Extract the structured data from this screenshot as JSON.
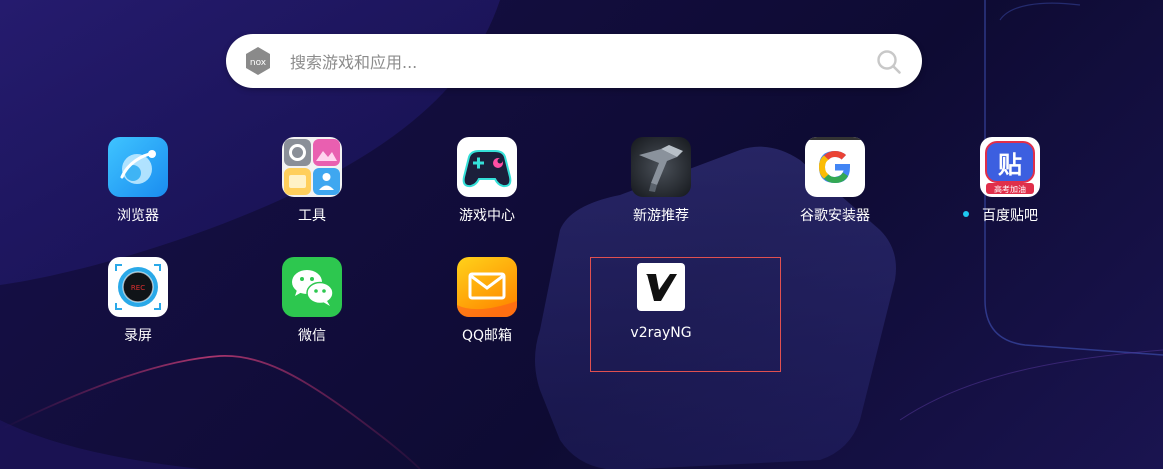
{
  "search": {
    "placeholder": "搜索游戏和应用...",
    "logo_text": "nox",
    "search_icon": "search-icon",
    "logo_icon": "nox-logo-icon"
  },
  "apps": [
    {
      "label": "浏览器",
      "icon": "browser-icon",
      "color": "#2ea8f5"
    },
    {
      "label": "工具",
      "icon": "tools-folder-icon",
      "color": "#ffffff"
    },
    {
      "label": "游戏中心",
      "icon": "game-controller-icon",
      "color": "#1b1f3b"
    },
    {
      "label": "新游推荐",
      "icon": "new-games-icon",
      "color": "#2b3038"
    },
    {
      "label": "谷歌安装器",
      "icon": "google-icon",
      "color": "#ffffff"
    },
    {
      "label": "百度贴吧",
      "icon": "tieba-icon",
      "color": "#3c5fe0",
      "badge_text": "高考加油",
      "glyph": "贴",
      "new_dot": true
    },
    {
      "label": "录屏",
      "icon": "screen-record-icon",
      "color": "#ffffff",
      "rec_text": "REC"
    },
    {
      "label": "微信",
      "icon": "wechat-icon",
      "color": "#2dc74f"
    },
    {
      "label": "QQ邮箱",
      "icon": "qq-mail-icon",
      "color": "#ffb300"
    },
    {
      "label": "v2rayNG",
      "icon": "v2rayng-icon",
      "color": "#ffffff",
      "selected": true
    }
  ],
  "colors": {
    "selection_border": "#e05050",
    "new_dot": "#1ec8f0",
    "label_text": "#ffffff"
  }
}
